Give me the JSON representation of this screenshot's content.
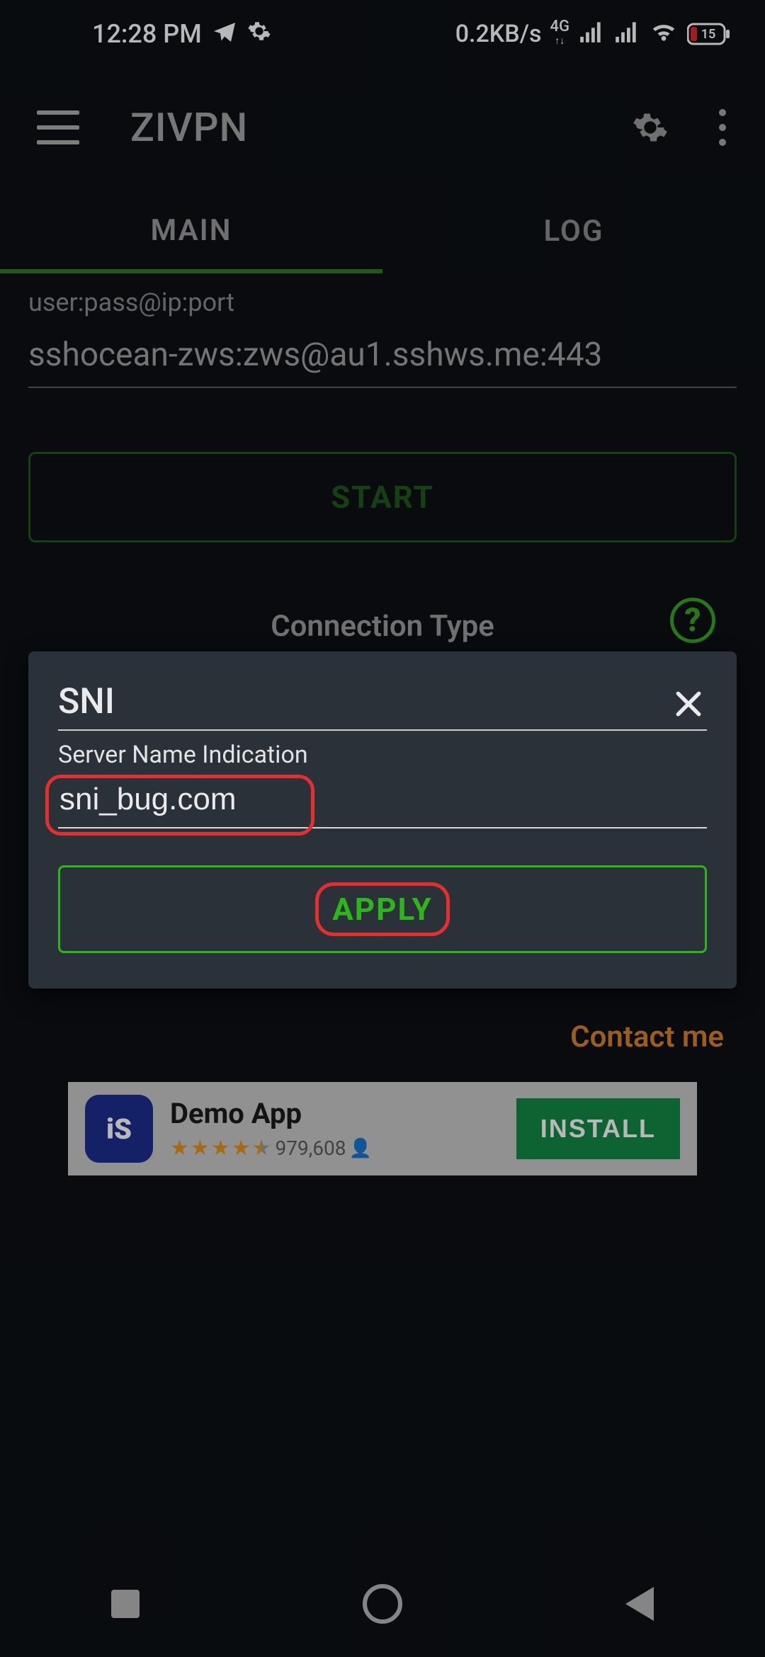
{
  "status": {
    "time": "12:28 PM",
    "net_speed": "0.2KB/s",
    "net_type": "4G",
    "battery_pct": "15"
  },
  "app": {
    "title": "ZIVPN"
  },
  "tabs": {
    "main": "MAIN",
    "log": "LOG"
  },
  "cred": {
    "label": "user:pass@ip:port",
    "value": "sshocean-zws:zws@au1.sshws.me:443"
  },
  "start_label": "START",
  "conn_type_label": "Connection Type",
  "modal": {
    "title": "SNI",
    "sub": "Server Name Indication",
    "value": "sni_bug.com",
    "apply": "APPLY"
  },
  "contact": "Contact me",
  "ad": {
    "title": "Demo App",
    "count": "979,608",
    "install": "INSTALL"
  }
}
